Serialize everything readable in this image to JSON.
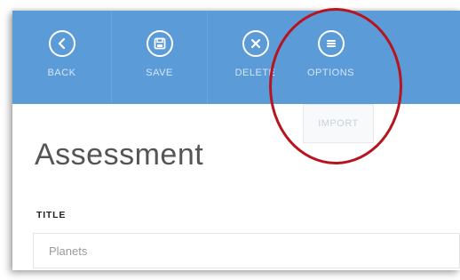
{
  "toolbar": {
    "back_label": "BACK",
    "save_label": "SAVE",
    "delete_label": "DELETE",
    "options_label": "OPTIONS",
    "accent": "#5b9bd8"
  },
  "options_menu": {
    "items": [
      {
        "label": "IMPORT"
      }
    ]
  },
  "page": {
    "title": "Assessment"
  },
  "form": {
    "title_label": "TITLE",
    "title_value": "Planets"
  },
  "annotation": {
    "ring_color": "#b7141e"
  }
}
